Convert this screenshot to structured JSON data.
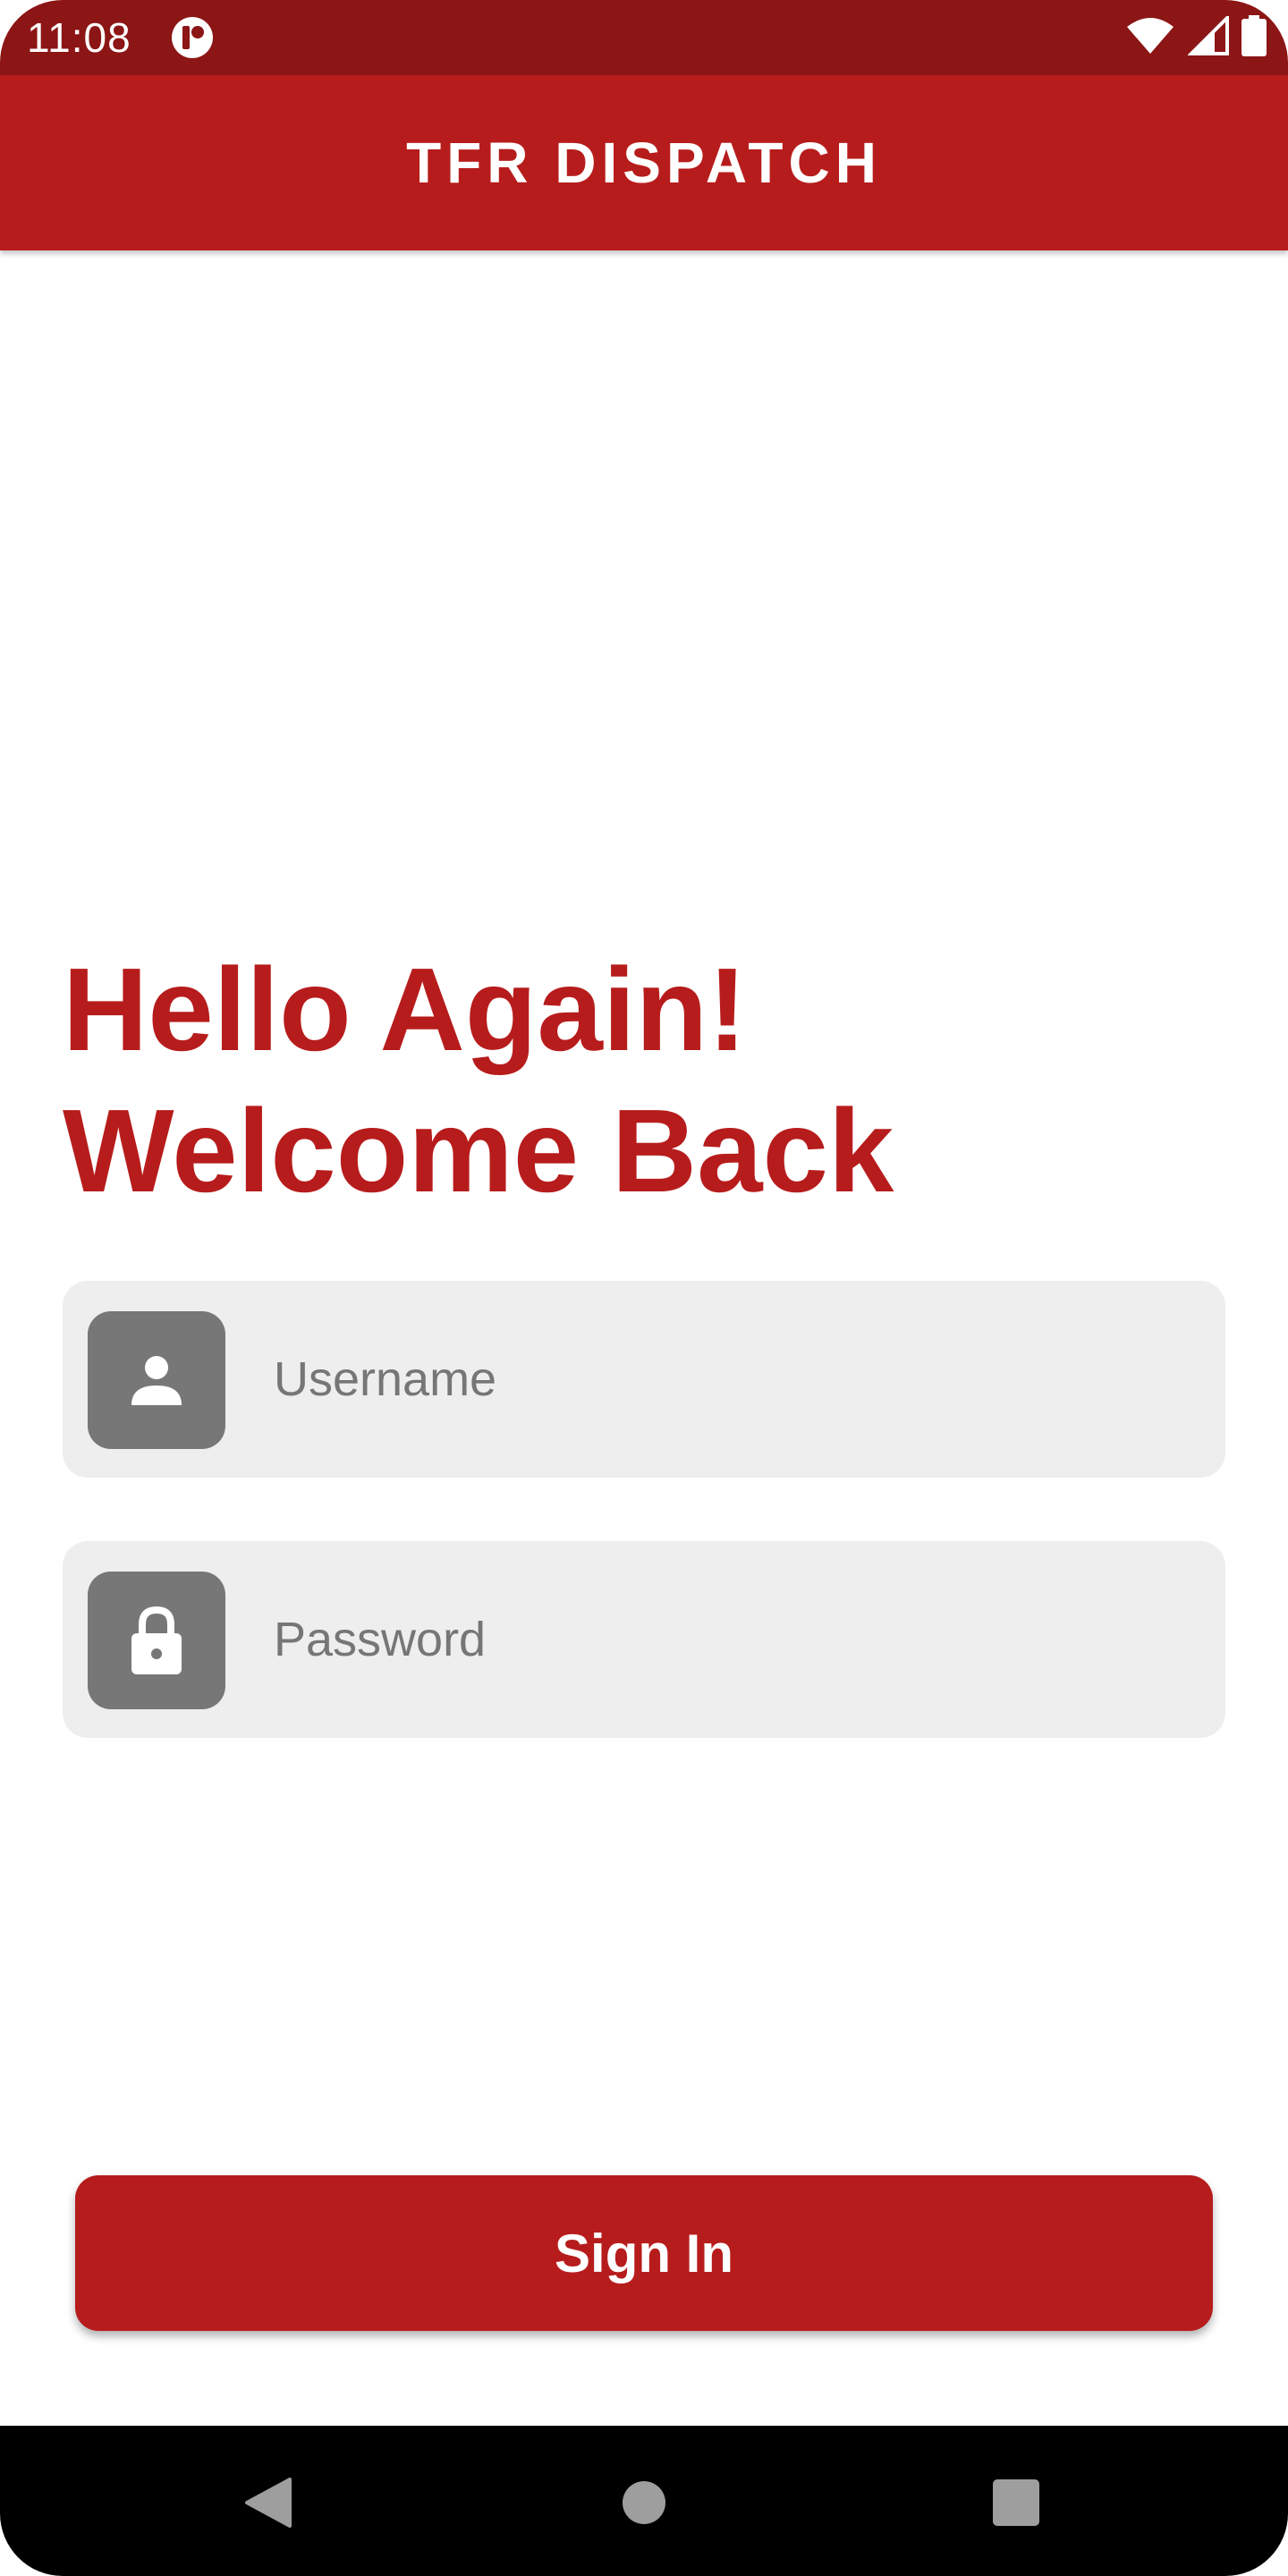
{
  "status_bar": {
    "time": "11:08",
    "icons": [
      "app-notification-icon",
      "wifi-icon",
      "signal-icon",
      "battery-icon"
    ]
  },
  "app_bar": {
    "title": "TFR DISPATCH"
  },
  "greeting": {
    "line1": "Hello Again!",
    "line2": "Welcome Back"
  },
  "form": {
    "username": {
      "placeholder": "Username",
      "value": "",
      "icon": "person-icon"
    },
    "password": {
      "placeholder": "Password",
      "value": "",
      "icon": "lock-icon"
    }
  },
  "actions": {
    "sign_in_label": "Sign In"
  },
  "nav_bar": {
    "icons": [
      "back-icon",
      "home-icon",
      "recents-icon"
    ]
  },
  "colors": {
    "primary": "#b71c1c",
    "status_bar": "#8c1515",
    "field_background": "#eeeeee",
    "icon_box": "#777777",
    "nav_bar": "#000000"
  }
}
